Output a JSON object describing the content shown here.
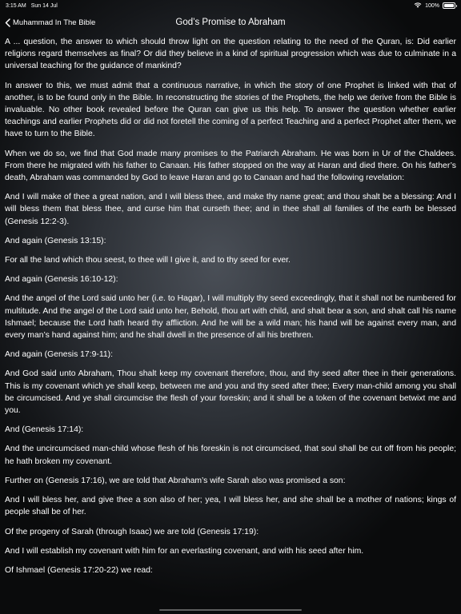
{
  "status_bar": {
    "time": "3:15 AM",
    "date": "Sun 14 Jul",
    "battery": "100%"
  },
  "nav": {
    "back_label": "Muhammad In The Bible",
    "title": "God’s Promise to Abraham"
  },
  "paragraphs": [
    "A ... question, the answer to which should throw light on the question relating to the need of the Quran, is: Did earlier religions regard themselves as final? Or did they believe in a kind of spiritual progression which was due to culminate in a universal teaching for the guidance of mankind?",
    "In answer to this, we must admit that a continuous narrative, in which the story of one Prophet is linked with that of another, is to be found only in the Bible. In reconstructing the stories of the Prophets, the help we derive from the Bible is invaluable. No other book revealed before the Quran can give us this help. To answer the question whether earlier teachings and earlier Prophets did or did not foretell the coming of a perfect Teaching and a perfect Prophet after them, we have to turn to the Bible.",
    "When we do so, we find that God made many promises to the Patriarch Abraham. He was born in Ur of the Chaldees. From there he migrated with his father to Canaan. His father stopped on the way at Haran and died there. On his father’s death, Abraham was commanded by God to leave Haran and go to Canaan and had the following revelation:",
    "And I will make of thee a great nation, and I will bless thee, and make thy name great; and thou shalt be a blessing: And I will bless them that bless thee, and curse him that curseth thee; and in thee shall all families of the earth be blessed (Genesis 12:2-3).",
    "And again (Genesis 13:15):",
    "For all the land which thou seest, to thee will I give it, and to thy seed for ever.",
    "And again (Genesis 16:10-12):",
    "And the angel of the Lord said unto her (i.e. to Hagar), I will multiply thy seed exceedingly, that it shall not be numbered for multitude. And the angel of the Lord said unto her, Behold, thou art with child, and shalt bear a son, and shalt call his name Ishmael; because the Lord hath heard thy affliction. And he will be a wild man; his hand will be against every man, and every man’s hand against him; and he shall dwell in the presence of all his brethren.",
    "And again (Genesis 17:9-11):",
    "And God said unto Abraham, Thou shalt keep my covenant therefore, thou, and thy seed after thee in their generations. This is my covenant which ye shall keep, between me and you and thy seed after thee; Every man-child among you shall be circumcised. And ye shall circumcise the flesh of your foreskin; and it shall be a token of the covenant betwixt me and you.",
    "And (Genesis 17:14):",
    "And the uncircumcised man-child whose flesh of his foreskin is not circumcised, that soul shall be cut off from his people; he hath broken my covenant.",
    "Further on (Genesis 17:16), we are told that Abraham’s wife Sarah also was promised a son:",
    "And I will bless her, and give thee a son also of her; yea, I will bless her, and she shall be a mother of nations; kings of people shall be of her.",
    "Of the progeny of Sarah (through Isaac) we are told (Genesis 17:19):",
    "And I will establish my covenant with him for an everlasting covenant, and with his seed after him.",
    "Of Ishmael (Genesis 17:20-22) we read:"
  ],
  "icons": {
    "wifi": "wifi-icon",
    "battery": "battery-icon",
    "back": "chevron-left-icon"
  },
  "colors": {
    "text": "#ffffff",
    "background_center": "#4a4f57",
    "background_edge": "#0a0b0c"
  }
}
